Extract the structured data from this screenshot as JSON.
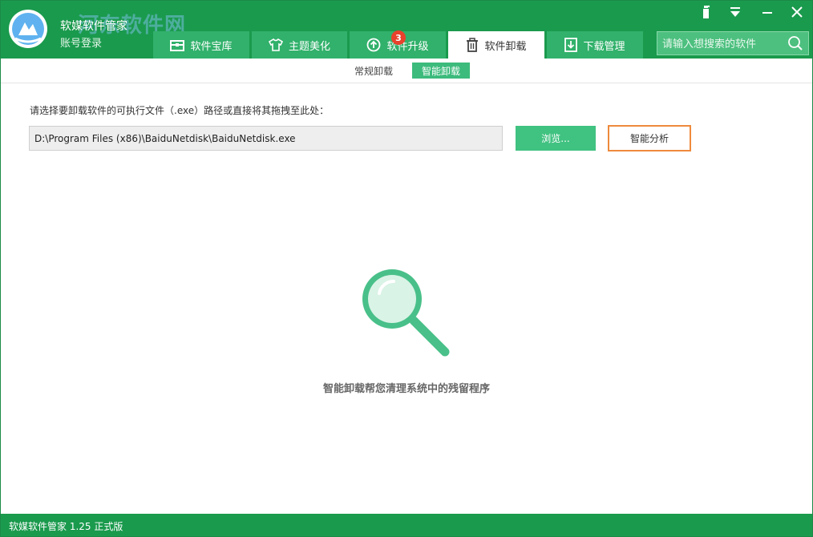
{
  "app": {
    "title": "软媒软件管家",
    "login": "账号登录",
    "watermark": "河东软件网"
  },
  "tabs": [
    {
      "label": "软件宝库",
      "icon": "toolbox-icon"
    },
    {
      "label": "主题美化",
      "icon": "tshirt-icon"
    },
    {
      "label": "软件升级",
      "icon": "upgrade-icon",
      "badge": "3"
    },
    {
      "label": "软件卸载",
      "icon": "trash-icon",
      "active": true
    },
    {
      "label": "下载管理",
      "icon": "download-icon"
    }
  ],
  "search": {
    "placeholder": "请输入想搜索的软件"
  },
  "subtabs": [
    {
      "label": "常规卸载",
      "active": false
    },
    {
      "label": "智能卸载",
      "active": true
    }
  ],
  "content": {
    "prompt": "请选择要卸载软件的可执行文件（.exe）路径或直接将其拖拽至此处：",
    "path_value": "D:\\Program Files (x86)\\BaiduNetdisk\\BaiduNetdisk.exe",
    "browse_label": "浏览...",
    "analyze_label": "智能分析",
    "hint": "智能卸载帮您清理系统中的残留程序"
  },
  "statusbar": {
    "version": "软媒软件管家 1.25 正式版"
  },
  "colors": {
    "brand_green": "#1a9a4d",
    "tab_green": "#31b16b",
    "accent_orange": "#ee8a3c",
    "magnifier": "#49c089"
  }
}
